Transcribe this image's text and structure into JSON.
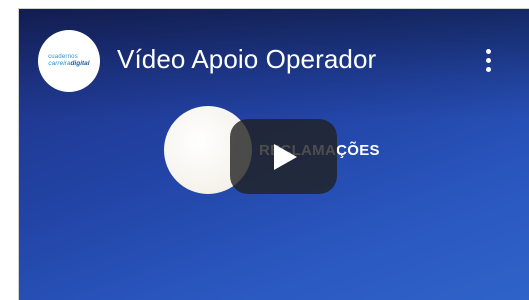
{
  "video": {
    "title": "Vídeo Apoio Operador",
    "thumbnail_text": "RECLAMAÇÕES"
  },
  "channel": {
    "logo_line1": "cuadernos",
    "logo_line2a": "carreira",
    "logo_line2b": "digital"
  },
  "icons": {
    "more": "more-vert-icon",
    "play": "play-icon"
  },
  "colors": {
    "background_dark": "#1d2f80",
    "background_light": "#2f63c9",
    "play_button": "#212121",
    "text": "#ffffff"
  }
}
